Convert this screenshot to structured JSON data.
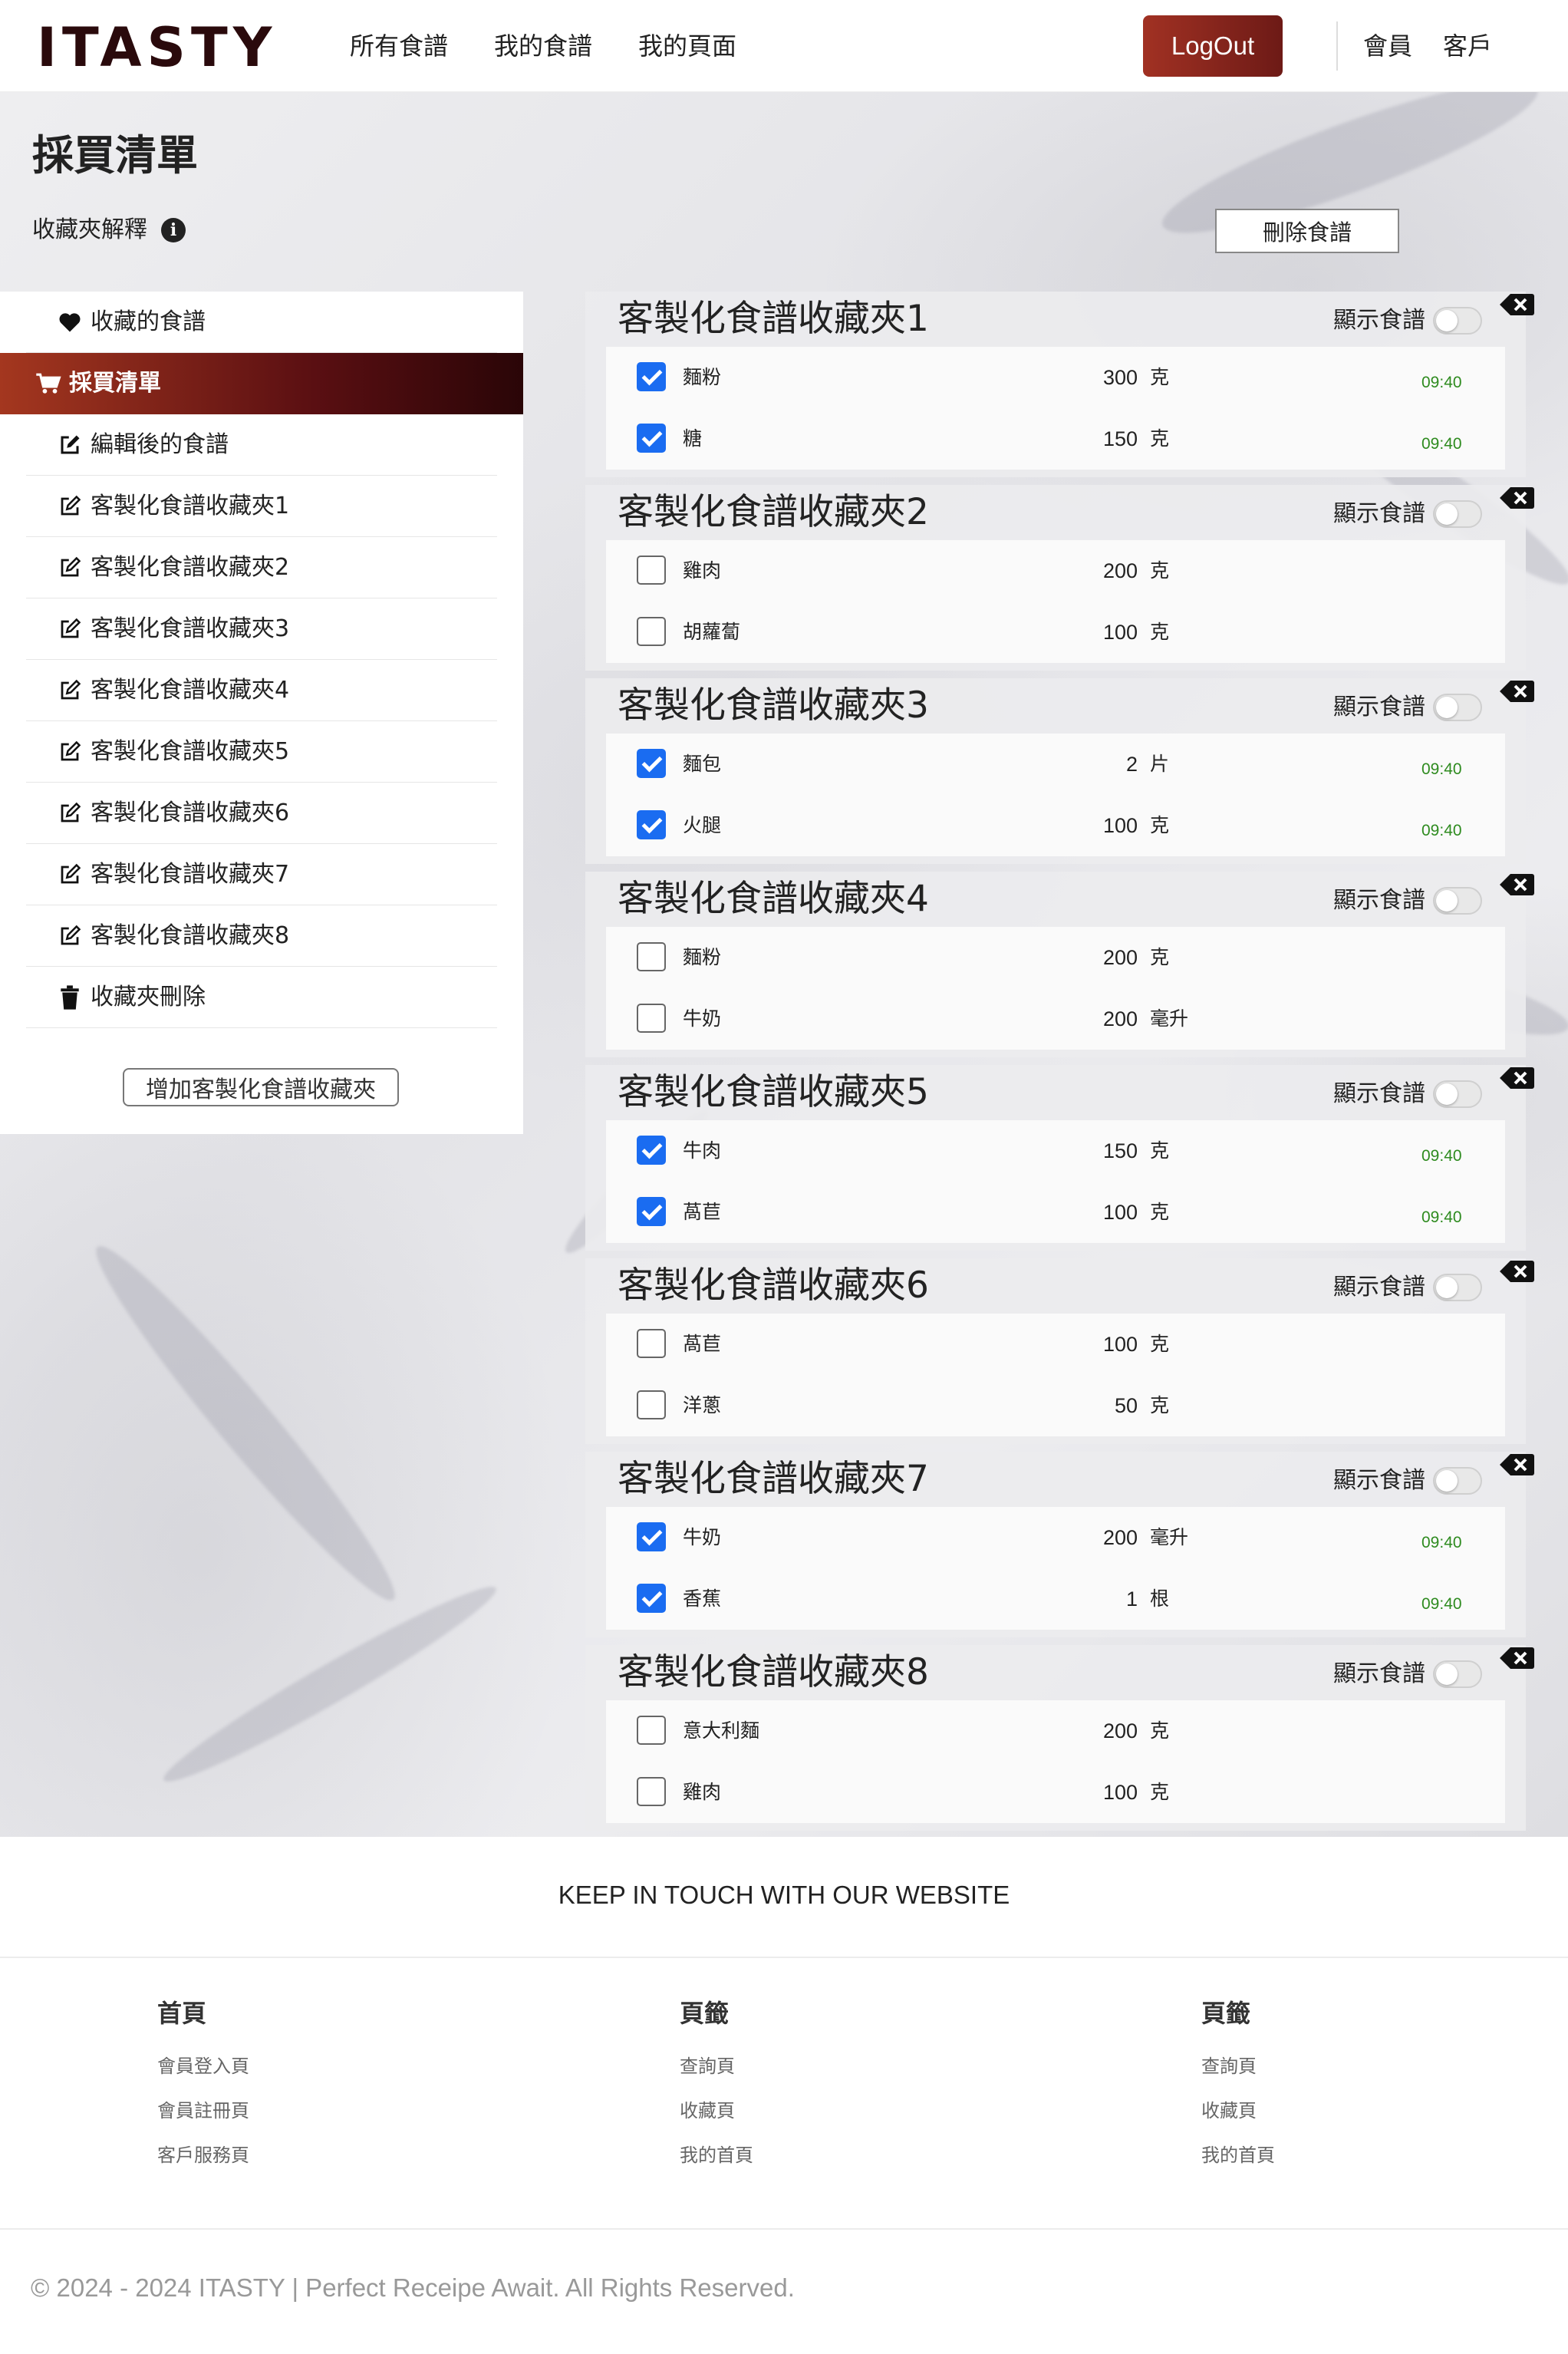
{
  "header": {
    "logo": "ITASTY",
    "nav": [
      "所有食譜",
      "我的食譜",
      "我的頁面"
    ],
    "logout_label": "LogOut",
    "right_links": [
      "會員",
      "客戶"
    ]
  },
  "page": {
    "title": "採買清單",
    "explain_label": "收藏夾解釋",
    "delete_recipe_label": "刪除食譜"
  },
  "sidebar": {
    "items": [
      {
        "label": "收藏的食譜",
        "icon": "heart-icon"
      },
      {
        "label": "採買清單",
        "icon": "cart-icon",
        "active": true
      },
      {
        "label": "編輯後的食譜",
        "icon": "edit-icon"
      },
      {
        "label": "客製化食譜收藏夾1",
        "icon": "edit-icon"
      },
      {
        "label": "客製化食譜收藏夾2",
        "icon": "edit-icon"
      },
      {
        "label": "客製化食譜收藏夾3",
        "icon": "edit-icon"
      },
      {
        "label": "客製化食譜收藏夾4",
        "icon": "edit-icon"
      },
      {
        "label": "客製化食譜收藏夾5",
        "icon": "edit-icon"
      },
      {
        "label": "客製化食譜收藏夾6",
        "icon": "edit-icon"
      },
      {
        "label": "客製化食譜收藏夾7",
        "icon": "edit-icon"
      },
      {
        "label": "客製化食譜收藏夾8",
        "icon": "edit-icon"
      },
      {
        "label": "收藏夾刪除",
        "icon": "trash-icon"
      }
    ],
    "add_folder_label": "增加客製化食譜收藏夾"
  },
  "folders": [
    {
      "title": "客製化食譜收藏夾1",
      "show_label": "顯示食譜",
      "items": [
        {
          "name": "麵粉",
          "qty": "300",
          "unit": "克",
          "checked": true,
          "time": "09:40"
        },
        {
          "name": "糖",
          "qty": "150",
          "unit": "克",
          "checked": true,
          "time": "09:40"
        }
      ]
    },
    {
      "title": "客製化食譜收藏夾2",
      "show_label": "顯示食譜",
      "items": [
        {
          "name": "雞肉",
          "qty": "200",
          "unit": "克",
          "checked": false,
          "time": ""
        },
        {
          "name": "胡蘿蔔",
          "qty": "100",
          "unit": "克",
          "checked": false,
          "time": ""
        }
      ]
    },
    {
      "title": "客製化食譜收藏夾3",
      "show_label": "顯示食譜",
      "items": [
        {
          "name": "麵包",
          "qty": "2",
          "unit": "片",
          "checked": true,
          "time": "09:40"
        },
        {
          "name": "火腿",
          "qty": "100",
          "unit": "克",
          "checked": true,
          "time": "09:40"
        }
      ]
    },
    {
      "title": "客製化食譜收藏夾4",
      "show_label": "顯示食譜",
      "items": [
        {
          "name": "麵粉",
          "qty": "200",
          "unit": "克",
          "checked": false,
          "time": ""
        },
        {
          "name": "牛奶",
          "qty": "200",
          "unit": "毫升",
          "checked": false,
          "time": ""
        }
      ]
    },
    {
      "title": "客製化食譜收藏夾5",
      "show_label": "顯示食譜",
      "items": [
        {
          "name": "牛肉",
          "qty": "150",
          "unit": "克",
          "checked": true,
          "time": "09:40"
        },
        {
          "name": "萵苣",
          "qty": "100",
          "unit": "克",
          "checked": true,
          "time": "09:40"
        }
      ]
    },
    {
      "title": "客製化食譜收藏夾6",
      "show_label": "顯示食譜",
      "items": [
        {
          "name": "萵苣",
          "qty": "100",
          "unit": "克",
          "checked": false,
          "time": ""
        },
        {
          "name": "洋蔥",
          "qty": "50",
          "unit": "克",
          "checked": false,
          "time": ""
        }
      ]
    },
    {
      "title": "客製化食譜收藏夾7",
      "show_label": "顯示食譜",
      "items": [
        {
          "name": "牛奶",
          "qty": "200",
          "unit": "毫升",
          "checked": true,
          "time": "09:40"
        },
        {
          "name": "香蕉",
          "qty": "1",
          "unit": "根",
          "checked": true,
          "time": "09:40"
        }
      ]
    },
    {
      "title": "客製化食譜收藏夾8",
      "show_label": "顯示食譜",
      "items": [
        {
          "name": "意大利麵",
          "qty": "200",
          "unit": "克",
          "checked": false,
          "time": ""
        },
        {
          "name": "雞肉",
          "qty": "100",
          "unit": "克",
          "checked": false,
          "time": ""
        }
      ]
    }
  ],
  "footer": {
    "keep_in_touch": "KEEP IN TOUCH WITH OUR WEBSITE",
    "columns": [
      {
        "title": "首頁",
        "links": [
          "會員登入頁",
          "會員註冊頁",
          "客戶服務頁"
        ]
      },
      {
        "title": "頁籤",
        "links": [
          "查詢頁",
          "收藏頁",
          "我的首頁"
        ]
      },
      {
        "title": "頁籤",
        "links": [
          "查詢頁",
          "收藏頁",
          "我的首頁"
        ]
      }
    ],
    "copyright": "© 2024 - 2024 ITASTY | Perfect Receipe Await. All Rights Reserved."
  },
  "colors": {
    "accent_dark": "#5a0f12",
    "accent_red": "#a4371f",
    "checkbox_blue": "#1a6cf1",
    "time_green": "#2e8b1f"
  }
}
